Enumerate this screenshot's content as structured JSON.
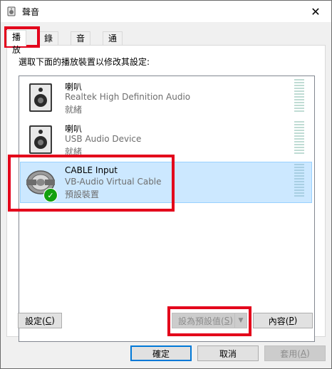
{
  "window": {
    "title": "聲音",
    "title_icon": "speaker-icon",
    "close_glyph": "✕"
  },
  "tabs": [
    {
      "label": "播放",
      "active": true
    },
    {
      "label": "錄製",
      "active": false
    },
    {
      "label": "音效",
      "active": false
    },
    {
      "label": "通訊",
      "active": false
    }
  ],
  "panel": {
    "instruction": "選取下面的播放裝置以修改其設定:"
  },
  "devices": [
    {
      "name": "喇叭",
      "description": "Realtek High Definition Audio",
      "status": "就緒",
      "icon": "speaker-box-icon",
      "selected": false,
      "default": false
    },
    {
      "name": "喇叭",
      "description": "USB Audio Device",
      "status": "就緒",
      "icon": "speaker-box-icon",
      "selected": false,
      "default": false
    },
    {
      "name": "CABLE Input",
      "description": "VB-Audio Virtual Cable",
      "status": "預設裝置",
      "icon": "cable-icon",
      "selected": true,
      "default": true
    }
  ],
  "buttons": {
    "configure": {
      "label": "設定(",
      "key": "C",
      "tail": ")"
    },
    "set_default": {
      "label": "設為預設值(",
      "key": "S",
      "tail": ")",
      "disabled": true
    },
    "properties": {
      "label": "內容(",
      "key": "P",
      "tail": ")"
    },
    "ok": {
      "label": "確定"
    },
    "cancel": {
      "label": "取消"
    },
    "apply": {
      "label": "套用(",
      "key": "A",
      "tail": ")",
      "disabled": true
    }
  },
  "colors": {
    "accent": "#0078d7",
    "selection": "#cce8ff",
    "highlight": "#e3001b",
    "default_check": "#13a10e"
  }
}
